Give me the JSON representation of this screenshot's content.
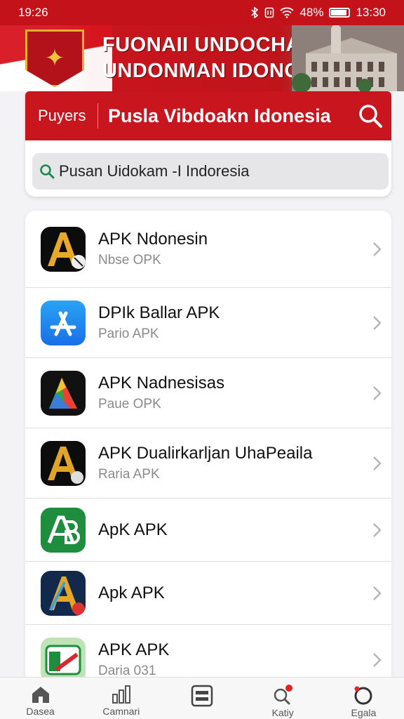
{
  "status_bar": {
    "time": "19:26",
    "battery": "48%",
    "clock_right": "13:30"
  },
  "banner": {
    "line1": "FUONAII UNDOCHAN",
    "line2": "UNDONMAN IDONOSMI"
  },
  "header": {
    "left_label": "Puyers",
    "title": "Pusla Vibdoakn Idonesia"
  },
  "search": {
    "value": "Pusan Uidokam -I Indoresia"
  },
  "apps": [
    {
      "title": "APK Ndonesin",
      "subtitle": "Nbse OPK"
    },
    {
      "title": "DPIk Ballar APK",
      "subtitle": "Pario APK"
    },
    {
      "title": "APK Nadnesisas",
      "subtitle": "Paue OPK"
    },
    {
      "title": "APK Dualirkarljan UhaPeaila",
      "subtitle": "Raria APK"
    },
    {
      "title": "ApK APK",
      "subtitle": ""
    },
    {
      "title": "Apk APK",
      "subtitle": ""
    },
    {
      "title": "APK APK",
      "subtitle": "Daria 031"
    }
  ],
  "bottom_nav": [
    {
      "label": "Dasea",
      "icon": "home-icon"
    },
    {
      "label": "Camnari",
      "icon": "chart-icon"
    },
    {
      "label": "",
      "icon": "menu-icon"
    },
    {
      "label": "Katiy",
      "icon": "search-badge-icon"
    },
    {
      "label": "Egala",
      "icon": "profile-ring-icon"
    }
  ],
  "colors": {
    "primary_red": "#c9161e",
    "background": "#f3f3f5"
  }
}
